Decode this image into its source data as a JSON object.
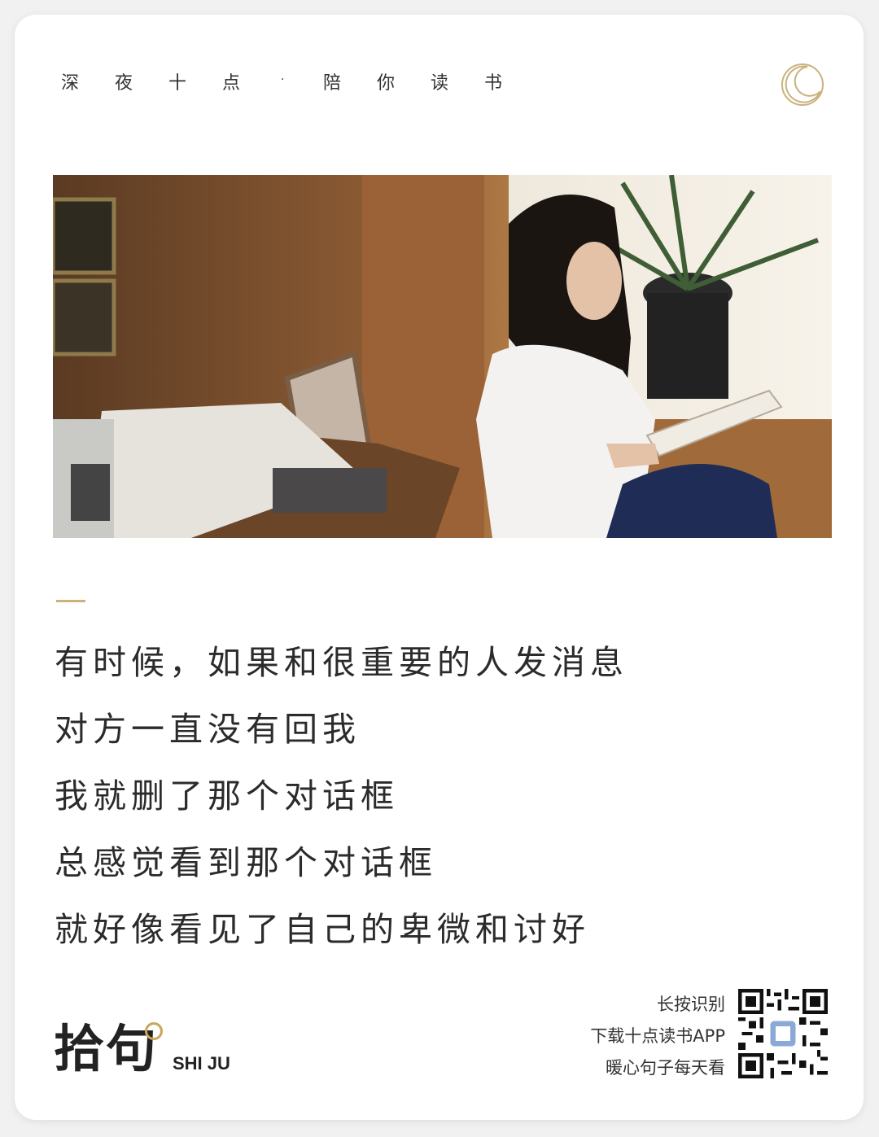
{
  "header": {
    "brand_chars": [
      "深",
      "夜",
      "十",
      "点",
      "·",
      "陪",
      "你",
      "读",
      "书"
    ]
  },
  "colors": {
    "accent_gold": "#c9b27c",
    "text_dark": "#2b2b2b"
  },
  "quote_lines": [
    "有时候，如果和很重要的人发消息",
    "对方一直没有回我",
    "我就删了那个对话框",
    "总感觉看到那个对话框",
    "就好像看见了自己的卑微和讨好"
  ],
  "footer": {
    "logo_zh": "拾句",
    "logo_en": "SHI JU",
    "promo": [
      "长按识别",
      "下载十点读书APP",
      "暖心句子每天看"
    ]
  }
}
